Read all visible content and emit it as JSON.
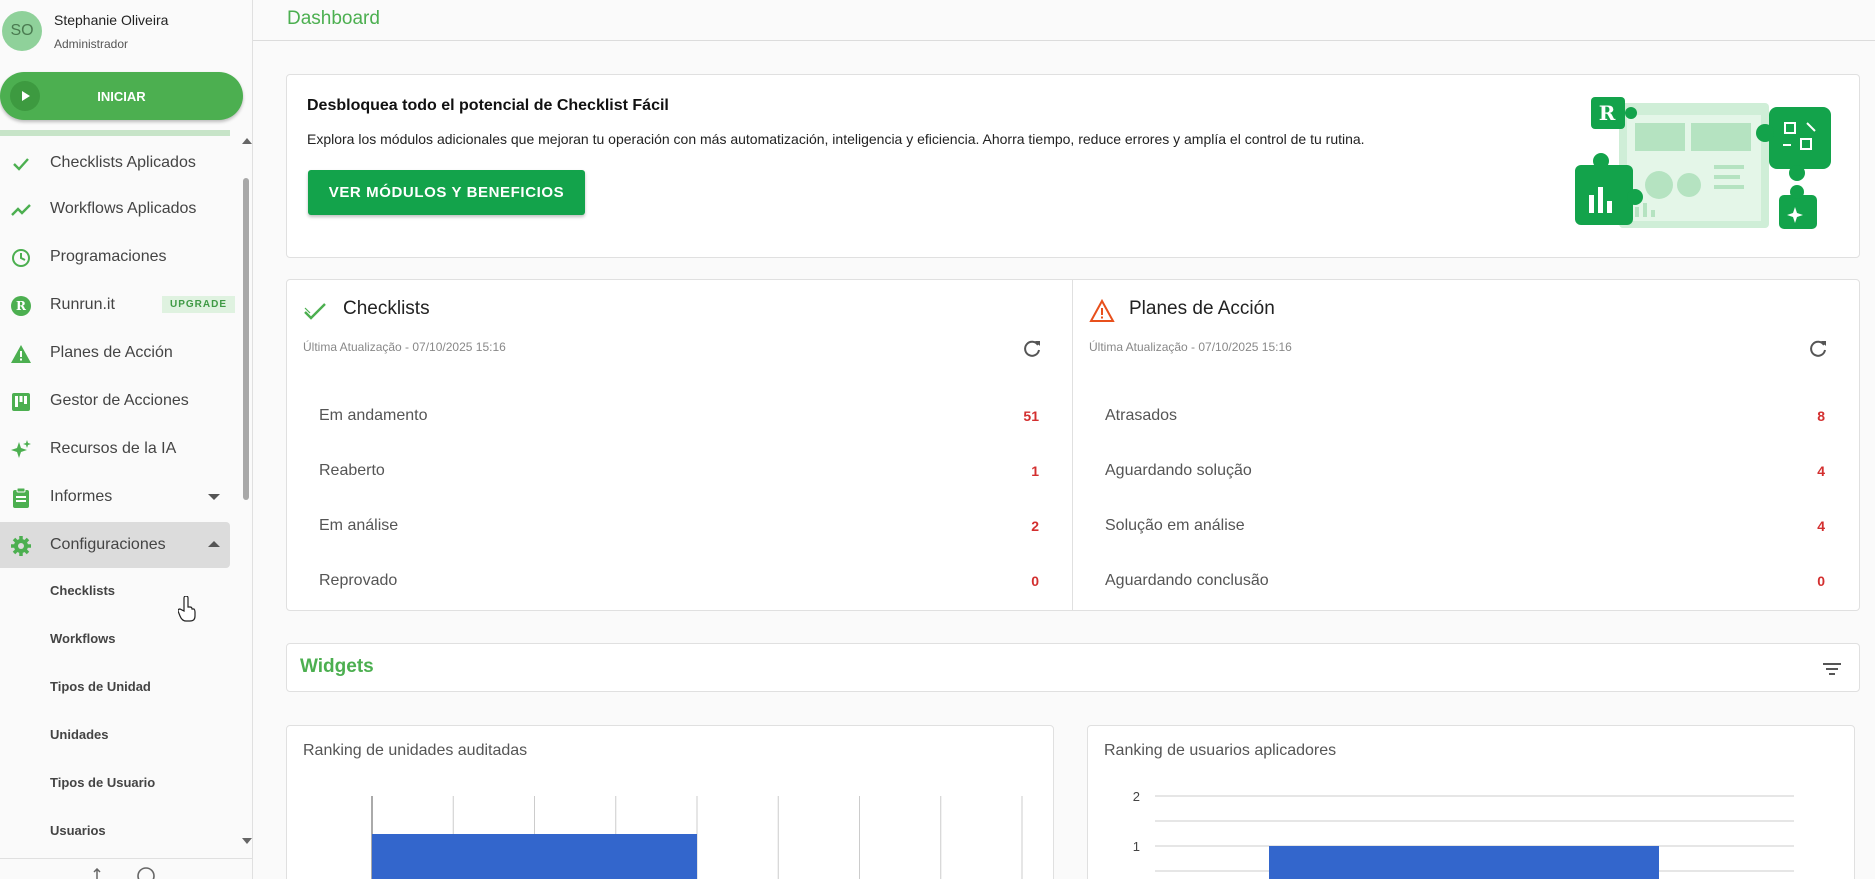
{
  "user": {
    "initials": "SO",
    "name": "Stephanie Oliveira",
    "role": "Administrador"
  },
  "start_button": {
    "label": "INICIAR"
  },
  "nav": {
    "items": [
      {
        "label": "Checklists Aplicados",
        "icon": "check-icon"
      },
      {
        "label": "Workflows Aplicados",
        "icon": "trend-line-icon"
      },
      {
        "label": "Programaciones",
        "icon": "clock-icon"
      },
      {
        "label": "Runrun.it",
        "icon": "runrun-logo-icon",
        "badge": "UPGRADE"
      },
      {
        "label": "Planes de Acción",
        "icon": "warning-icon"
      },
      {
        "label": "Gestor de Acciones",
        "icon": "kanban-icon"
      },
      {
        "label": "Recursos de la IA",
        "icon": "sparkle-icon"
      },
      {
        "label": "Informes",
        "icon": "clipboard-icon",
        "expandable": true,
        "expanded": false
      },
      {
        "label": "Configuraciones",
        "icon": "gear-icon",
        "expandable": true,
        "expanded": true,
        "active": true
      }
    ],
    "sub_items": [
      "Checklists",
      "Workflows",
      "Tipos de Unidad",
      "Unidades",
      "Tipos de Usuario",
      "Usuarios"
    ]
  },
  "page": {
    "title": "Dashboard"
  },
  "promo": {
    "title": "Desbloquea todo el potencial de Checklist Fácil",
    "description": "Explora los módulos adicionales que mejoran tu operación con más automatización, inteligencia y eficiencia. Ahorra tiempo, reduce errores y amplía el control de tu rutina.",
    "button_label": "VER MÓDULOS Y BENEFICIOS"
  },
  "checklists_panel": {
    "title": "Checklists",
    "updated": "Última Atualização - 07/10/2025 15:16",
    "rows": [
      {
        "label": "Em andamento",
        "value": "51"
      },
      {
        "label": "Reaberto",
        "value": "1"
      },
      {
        "label": "Em análise",
        "value": "2"
      },
      {
        "label": "Reprovado",
        "value": "0"
      }
    ]
  },
  "action_plans_panel": {
    "title": "Planes de Acción",
    "updated": "Última Atualização - 07/10/2025 15:16",
    "rows": [
      {
        "label": "Atrasados",
        "value": "8"
      },
      {
        "label": "Aguardando solução",
        "value": "4"
      },
      {
        "label": "Solução em análise",
        "value": "4"
      },
      {
        "label": "Aguardando conclusão",
        "value": "0"
      }
    ]
  },
  "widgets": {
    "title": "Widgets"
  },
  "chart_data": [
    {
      "type": "bar",
      "title": "Ranking de unidades auditadas",
      "orientation": "horizontal",
      "categories": [
        ""
      ],
      "values": [
        4
      ],
      "xlim": [
        0,
        8
      ],
      "grid": true
    },
    {
      "type": "bar",
      "title": "Ranking de usuarios aplicadores",
      "categories": [
        ""
      ],
      "values": [
        1
      ],
      "ylim": [
        0,
        2
      ],
      "y_ticks": [
        "2",
        "1"
      ],
      "grid": true
    }
  ],
  "colors": {
    "brand_green": "#4caf50",
    "button_green": "#13a34b",
    "value_red": "#d32f2f",
    "bar_blue": "#3366cc",
    "warning_orange": "#e8501c"
  }
}
